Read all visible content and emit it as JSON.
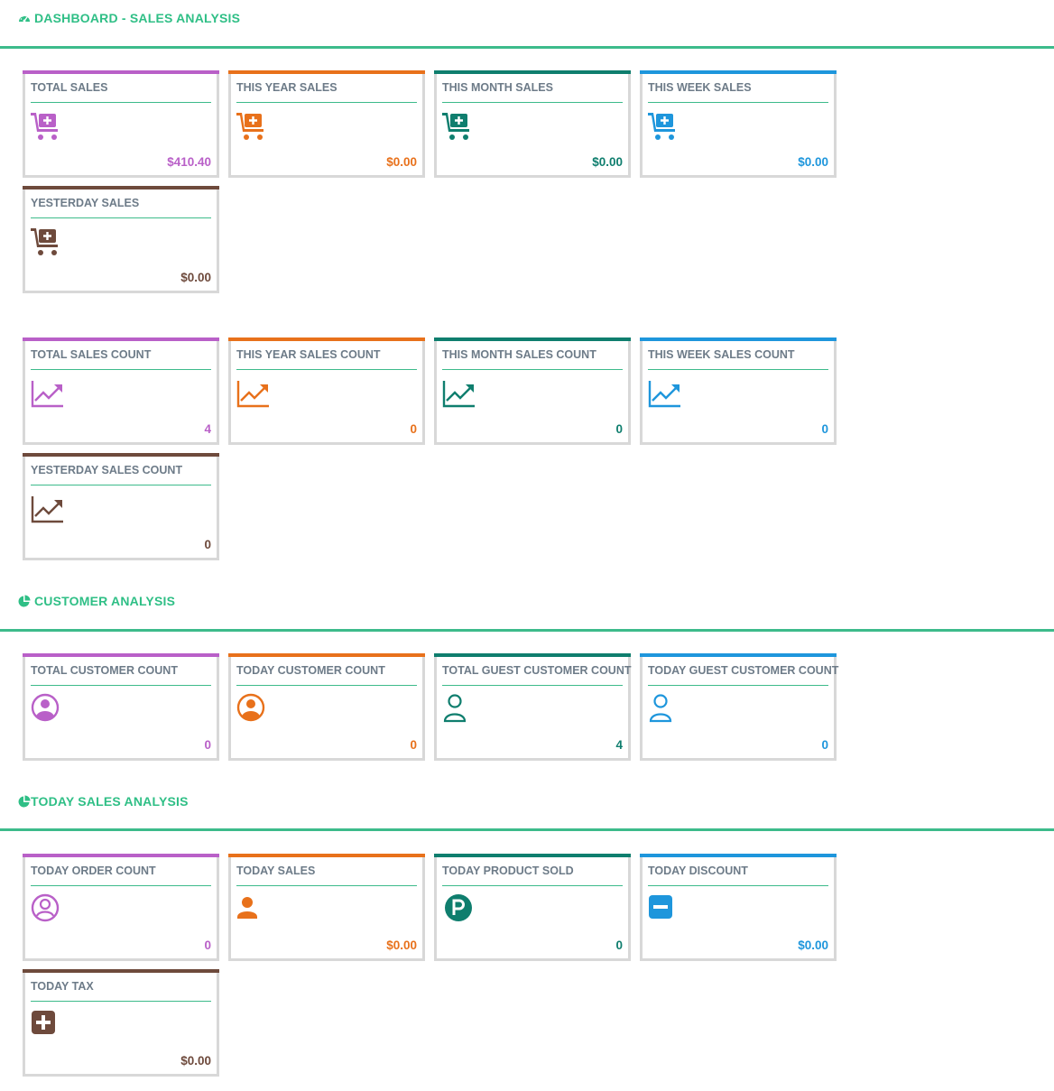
{
  "sections": {
    "sales": {
      "title": "DASHBOARD - SALES ANALYSIS",
      "icon": "dashboard-icon"
    },
    "customer": {
      "title": "CUSTOMER ANALYSIS",
      "icon": "pie-chart-icon"
    },
    "today": {
      "title": "TODAY SALES ANALYSIS",
      "icon": "pie-chart-icon"
    }
  },
  "colors": {
    "accent": "#2fbf86",
    "purple": "#b960c8",
    "orange": "#e8711b",
    "teal": "#0f7e6e",
    "blue": "#1e96dc",
    "brown": "#6e4a3c"
  },
  "sales_cards": [
    {
      "title": "TOTAL SALES",
      "value": "$410.40",
      "icon": "cart-plus-icon"
    },
    {
      "title": "THIS YEAR SALES",
      "value": "$0.00",
      "icon": "cart-plus-icon"
    },
    {
      "title": "THIS MONTH SALES",
      "value": "$0.00",
      "icon": "cart-plus-icon"
    },
    {
      "title": "THIS WEEK SALES",
      "value": "$0.00",
      "icon": "cart-plus-icon"
    },
    {
      "title": "YESTERDAY SALES",
      "value": "$0.00",
      "icon": "cart-plus-icon"
    }
  ],
  "count_cards": [
    {
      "title": "TOTAL SALES COUNT",
      "value": "4",
      "icon": "trend-chart-icon"
    },
    {
      "title": "THIS YEAR SALES COUNT",
      "value": "0",
      "icon": "trend-chart-icon"
    },
    {
      "title": "THIS MONTH SALES COUNT",
      "value": "0",
      "icon": "trend-chart-icon"
    },
    {
      "title": "THIS WEEK SALES COUNT",
      "value": "0",
      "icon": "trend-chart-icon"
    },
    {
      "title": "YESTERDAY SALES COUNT",
      "value": "0",
      "icon": "trend-chart-icon"
    }
  ],
  "customer_cards": [
    {
      "title": "TOTAL CUSTOMER COUNT",
      "value": "0",
      "icon": "user-circle-icon"
    },
    {
      "title": "TODAY CUSTOMER COUNT",
      "value": "0",
      "icon": "user-circle-icon"
    },
    {
      "title": "TOTAL GUEST CUSTOMER COUNT",
      "value": "4",
      "icon": "user-outline-icon"
    },
    {
      "title": "TODAY GUEST CUSTOMER COUNT",
      "value": "0",
      "icon": "user-outline-icon"
    }
  ],
  "today_cards": [
    {
      "title": "TODAY ORDER COUNT",
      "value": "0",
      "icon": "user-circle-outline-icon"
    },
    {
      "title": "TODAY SALES",
      "value": "$0.00",
      "icon": "user-icon"
    },
    {
      "title": "TODAY PRODUCT SOLD",
      "value": "0",
      "icon": "product-p-icon"
    },
    {
      "title": "TODAY DISCOUNT",
      "value": "$0.00",
      "icon": "minus-square-icon"
    },
    {
      "title": "TODAY TAX",
      "value": "$0.00",
      "icon": "plus-square-icon"
    }
  ]
}
